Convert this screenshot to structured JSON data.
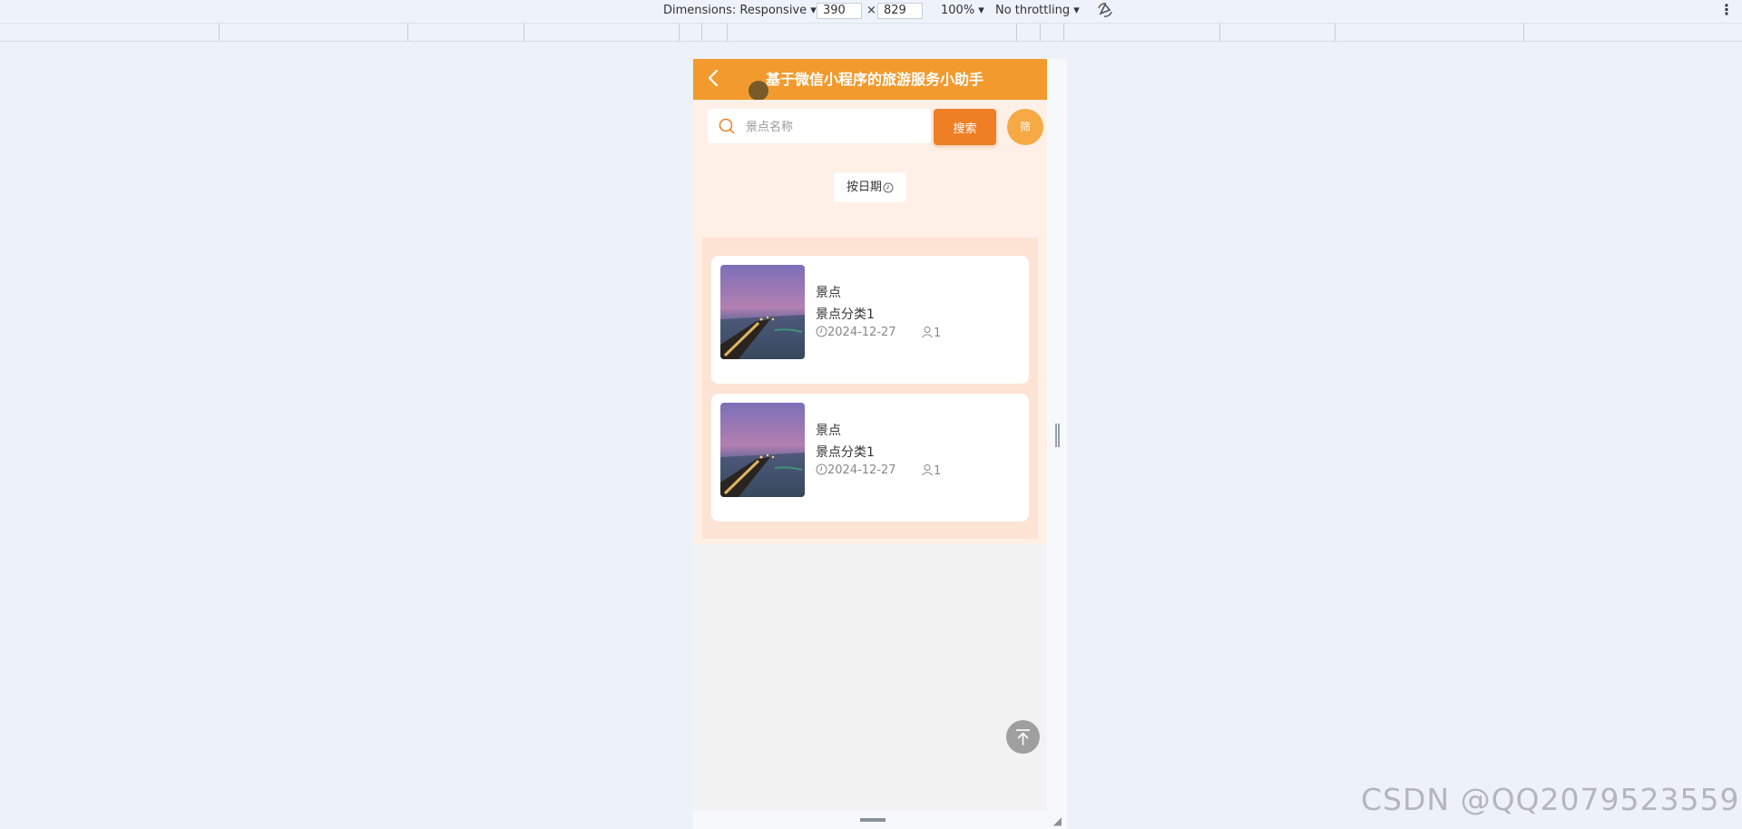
{
  "devtools": {
    "dimensions_label": "Dimensions: Responsive ▾",
    "width": "390",
    "times": "×",
    "height": "829",
    "zoom": "100% ▾",
    "throttling": "No throttling ▾",
    "more": "⋮"
  },
  "navbar": {
    "title": "基于微信小程序的旅游服务小助手",
    "back_icon": "chevron-left-icon"
  },
  "search": {
    "placeholder": "景点名称",
    "button_label": "搜索",
    "filter_label": "筛"
  },
  "sort": {
    "label": "按日期"
  },
  "list": [
    {
      "name": "景点",
      "category": "景点分类1",
      "date": "2024-12-27",
      "count": "1"
    },
    {
      "name": "景点",
      "category": "景点分类1",
      "date": "2024-12-27",
      "count": "1"
    }
  ],
  "colors": {
    "primary": "#f29a2e",
    "search_button": "#ef7f24",
    "filter_button": "#f6a944",
    "content_bg": "#fef0e7",
    "list_bg": "#fde3d3"
  },
  "watermark": "CSDN @QQ2079523559"
}
